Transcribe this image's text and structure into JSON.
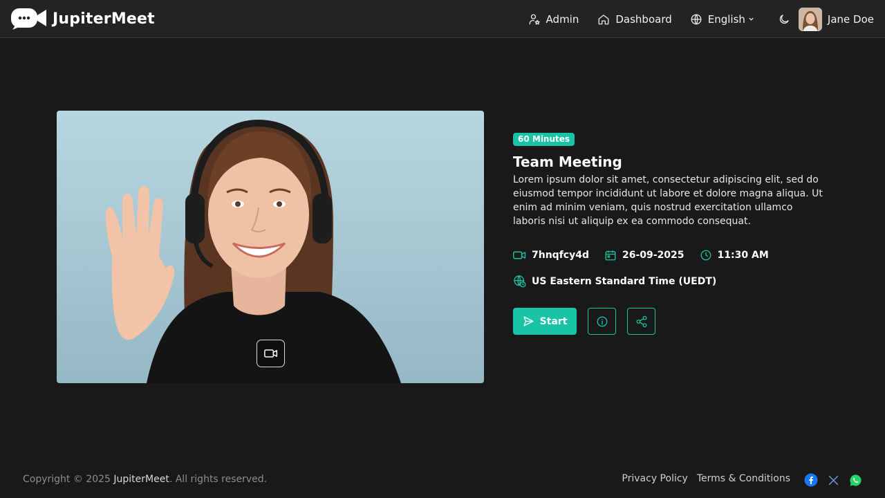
{
  "app": {
    "name": "JupiterMeet"
  },
  "header": {
    "nav": {
      "admin_label": "Admin",
      "dashboard_label": "Dashboard",
      "language_label": "English"
    },
    "user": {
      "name": "Jane Doe"
    }
  },
  "meeting": {
    "duration_badge": "60 Minutes",
    "title": "Team Meeting",
    "description": "Lorem ipsum dolor sit amet, consectetur adipiscing elit, sed do eiusmod tempor incididunt ut labore et dolore magna aliqua. Ut enim ad minim veniam, quis nostrud exercitation ullamco laboris nisi ut aliquip ex ea commodo consequat.",
    "meeting_id": "7hnqfcy4d",
    "date": "26-09-2025",
    "time": "11:30 AM",
    "timezone": "US Eastern Standard Time (UEDT)",
    "start_label": "Start"
  },
  "footer": {
    "copyright_prefix": "Copyright © 2025",
    "copyright_brand": "JupiterMeet",
    "copyright_suffix": ". All rights reserved.",
    "links": {
      "privacy": "Privacy Policy",
      "terms": "Terms & Conditions"
    }
  },
  "colors": {
    "accent": "#19c3a6",
    "background": "#19191a",
    "header": "#232324"
  },
  "icons": {
    "logo": "chat-camera-icon",
    "admin": "user-star-icon",
    "dashboard": "home-icon",
    "language": "globe-icon",
    "theme": "moon-icon",
    "camera": "video-camera-icon",
    "meeting_id": "video-icon",
    "date": "calendar-icon",
    "time": "clock-icon",
    "timezone": "globe-clock-icon",
    "start": "send-icon",
    "info": "info-icon",
    "share": "share-icon",
    "socials": [
      "facebook-icon",
      "x-icon",
      "whatsapp-icon"
    ]
  }
}
